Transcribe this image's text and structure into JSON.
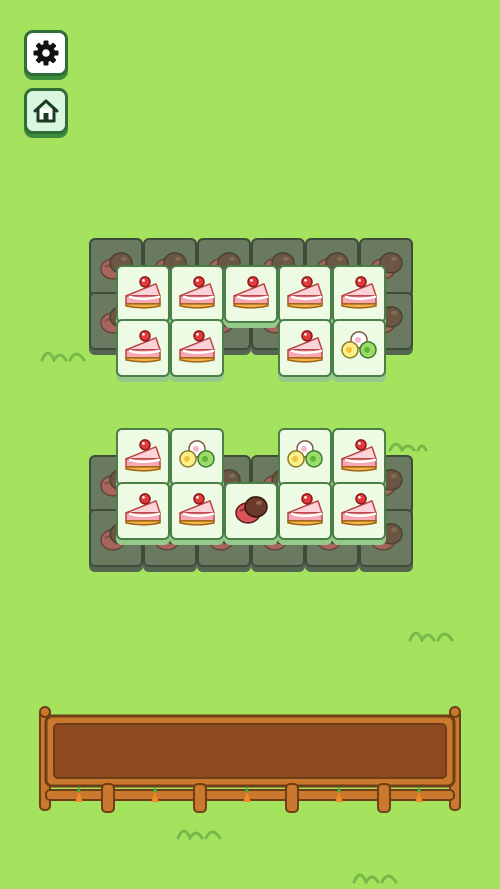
{
  "controls": {
    "settings_icon": "gear-icon",
    "home_icon": "home-icon"
  },
  "colors": {
    "background": "#a5e25e",
    "tile_face": "#eefbe4",
    "tile_border": "#4a7f48",
    "tile_blocked": "#6a7a60",
    "tray_wood": "#c9782e"
  },
  "board": {
    "upper_group": {
      "back_row_1": [
        "chocolate-icon",
        "chocolate-icon",
        "chocolate-icon",
        "chocolate-icon",
        "chocolate-icon",
        "chocolate-icon"
      ],
      "back_row_2": [
        "chocolate-icon",
        "chocolate-icon",
        "chocolate-icon",
        "chocolate-icon",
        "chocolate-icon",
        "chocolate-icon"
      ],
      "front_row_1": [
        "cake-slice-icon",
        "cake-slice-icon",
        "cake-slice-icon",
        "cake-slice-icon",
        "cake-slice-icon"
      ],
      "front_row_2": [
        "cake-slice-icon",
        "cake-slice-icon",
        "cake-slice-icon",
        "mochi-icon"
      ]
    },
    "lower_group": {
      "back_row_1": [
        "chocolate-icon",
        "chocolate-icon",
        "chocolate-icon",
        "chocolate-icon",
        "chocolate-icon",
        "chocolate-icon"
      ],
      "back_row_2": [
        "chocolate-icon",
        "chocolate-icon",
        "chocolate-icon",
        "chocolate-icon",
        "chocolate-icon",
        "chocolate-icon"
      ],
      "front_row_1": [
        "cake-slice-icon",
        "mochi-icon",
        "mochi-icon",
        "cake-slice-icon"
      ],
      "front_row_2": [
        "cake-slice-icon",
        "cake-slice-icon",
        "chocolate-icon",
        "cake-slice-icon",
        "cake-slice-icon"
      ]
    }
  },
  "tray": {
    "slots": 7,
    "filled": 0,
    "decor_icon": "carrot-icon"
  }
}
